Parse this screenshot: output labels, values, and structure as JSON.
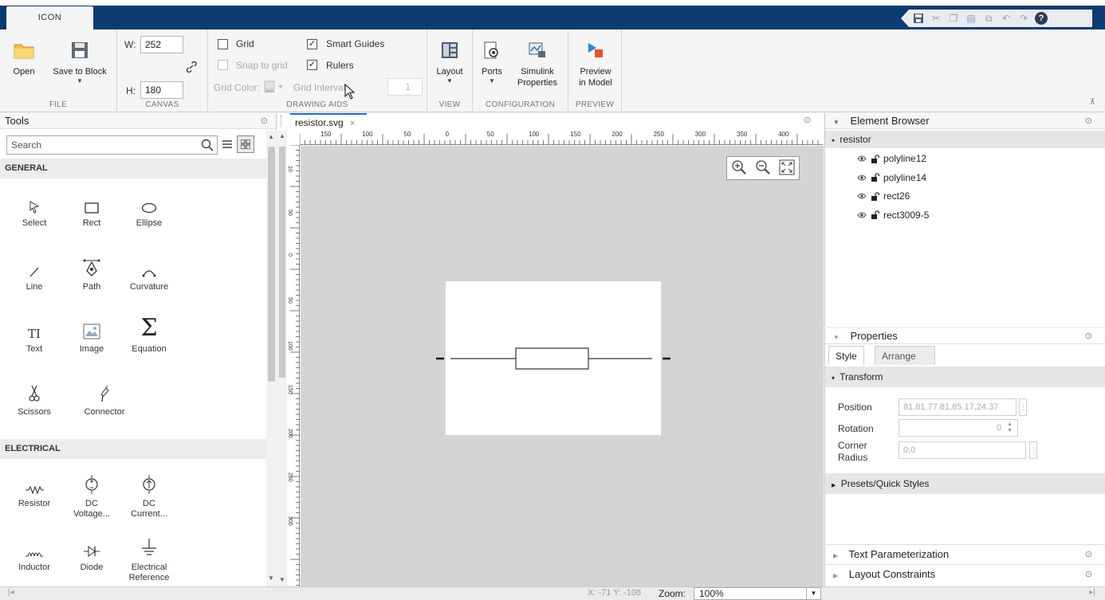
{
  "ribbon": {
    "tab": "ICON",
    "sections": {
      "file": "FILE",
      "canvas": "CANVAS",
      "drawing_aids": "DRAWING AIDS",
      "view": "VIEW",
      "configuration": "CONFIGURATION",
      "preview": "PREVIEW"
    },
    "buttons": {
      "open": "Open",
      "save_to_block": "Save to Block",
      "layout": "Layout",
      "ports": "Ports",
      "simulink_properties_1": "Simulink",
      "simulink_properties_2": "Properties",
      "preview_1": "Preview",
      "preview_2": "in Model"
    },
    "canvas": {
      "w_label": "W:",
      "w_value": "252",
      "h_label": "H:",
      "h_value": "180"
    },
    "drawing_aids": {
      "grid": "Grid",
      "smart_guides": "Smart Guides",
      "snap_to_grid": "Snap to grid",
      "rulers": "Rulers",
      "grid_color": "Grid Color:",
      "grid_interval": "Grid Interval:",
      "grid_interval_value": "1",
      "smart_guides_checked": "✓",
      "rulers_checked": "✓"
    }
  },
  "tools": {
    "title": "Tools",
    "search_placeholder": "Search",
    "general_heading": "GENERAL",
    "electrical_heading": "ELECTRICAL",
    "general": [
      "Select",
      "Rect",
      "Ellipse",
      "Line",
      "Path",
      "Curvature",
      "Text",
      "Image",
      "Equation",
      "Scissors",
      "Connector"
    ],
    "electrical": [
      [
        "Resistor"
      ],
      [
        "DC",
        "Voltage..."
      ],
      [
        "DC",
        "Current..."
      ],
      [
        "Inductor"
      ],
      [
        "Diode"
      ],
      [
        "Electrical",
        "Reference"
      ]
    ]
  },
  "document": {
    "tab": "resistor.svg",
    "ruler_labels": [
      "150",
      "100",
      "50",
      "0",
      "50",
      "100",
      "150",
      "200",
      "250",
      "300",
      "350",
      "400"
    ],
    "ruler_left_labels": [
      "10",
      "50",
      "0",
      "50",
      "100",
      "150",
      "200",
      "250",
      "300"
    ]
  },
  "element_browser": {
    "title": "Element Browser",
    "root": "resistor",
    "items": [
      "polyline12",
      "polyline14",
      "rect26",
      "rect3009-5"
    ]
  },
  "properties": {
    "title": "Properties",
    "tab_style": "Style",
    "tab_arrange": "Arrange",
    "transform": "Transform",
    "position_label": "Position",
    "position_value": "81.81,77.81,85.17,24.37",
    "rotation_label": "Rotation",
    "rotation_value": "0",
    "corner_label_1": "Corner",
    "corner_label_2": "Radius",
    "corner_value": "0,0",
    "presets": "Presets/Quick Styles"
  },
  "text_parameterization": "Text Parameterization",
  "layout_constraints": "Layout Constraints",
  "status": {
    "coords": "X: -71 Y: -108",
    "zoom_label": "Zoom:",
    "zoom_value": "100%"
  }
}
